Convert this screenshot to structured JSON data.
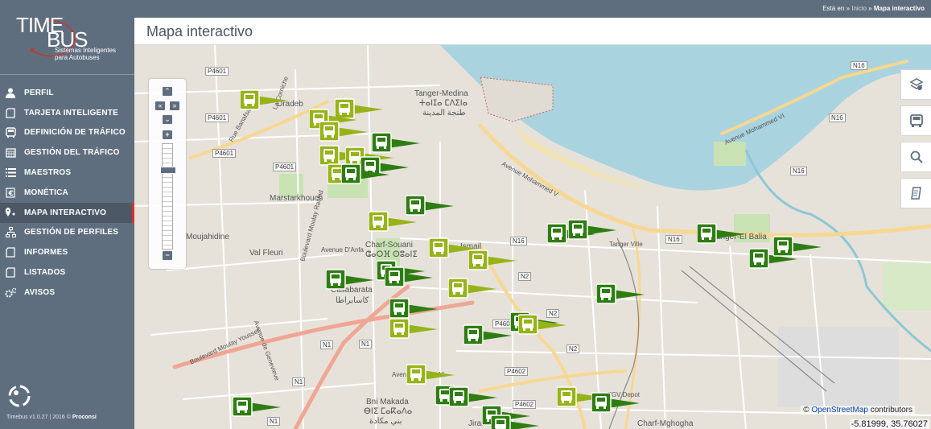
{
  "brand": {
    "name_line1": "TIME",
    "name_line2": "BUS",
    "tagline": "Sistemas Inteligentes para Autobuses",
    "version": "Timebus v1.0.27 | 2016 ©",
    "company": "Proconsi"
  },
  "breadcrumb": {
    "prefix": "Está en »",
    "home": "Inicio",
    "sep": "»",
    "current": "Mapa interactivo"
  },
  "page_title": "Mapa interactivo",
  "menu": [
    {
      "label": "PERFIL",
      "icon": "user-icon"
    },
    {
      "label": "TARJETA INTELIGENTE",
      "icon": "card-icon"
    },
    {
      "label": "DEFINICIÓN DE TRÁFICO",
      "icon": "bus-icon"
    },
    {
      "label": "GESTIÓN DEL TRÁFICO",
      "icon": "calendar-icon"
    },
    {
      "label": "MAESTROS",
      "icon": "list-icon"
    },
    {
      "label": "MONÉTICA",
      "icon": "money-icon"
    },
    {
      "label": "MAPA INTERACTIVO",
      "icon": "map-pin-icon",
      "active": true
    },
    {
      "label": "GESTIÓN DE PERFILES",
      "icon": "sitemap-icon"
    },
    {
      "label": "INFORMES",
      "icon": "report-icon"
    },
    {
      "label": "LISTADOS",
      "icon": "listing-icon"
    },
    {
      "label": "AVISOS",
      "icon": "gears-icon"
    }
  ],
  "map_tools": [
    "layers-map-icon",
    "bus-icon",
    "search-icon",
    "document-icon"
  ],
  "map_labels": {
    "places": [
      "Tanger-Medina",
      "ⵜⴰⵏⵊⴰ ⵎⴷⵉⵏⴰ",
      "طنجة المدينة",
      "Dradeb",
      "Marstarkhouch",
      "Moujahidine",
      "Val Fleuri",
      "Charf-Souani",
      "ⵛⴰⵔⴼ ⵙⵓⴰⵏⵉ",
      "Casabarata",
      "كاسابراطا",
      "Tanger-El Balia",
      "Tanger Ville",
      "Bni Makada",
      "ⴱⵏⵉ ⵎⴰⴽⴰⴷⴰ",
      "بني مكادة",
      "Charf-Mghogha",
      "Ismail",
      "Jirari",
      "TGV Depot"
    ],
    "roads": [
      "P4601",
      "P4601",
      "P4601",
      "P4601",
      "N16",
      "N16",
      "N16",
      "N16",
      "N16",
      "N2",
      "N2",
      "N2",
      "N1",
      "N1",
      "N1",
      "N1",
      "P4602",
      "P4602",
      "P4602"
    ],
    "streets": [
      "Avenue Mohammed VI",
      "Avenue Mohammed V",
      "Boulevard Moulay Rachid",
      "Avenue Moulay Ali",
      "Boulevard Moulay Youssef",
      "Avenue de Genevieve",
      "Avenue D'Anfa",
      "La Corniche",
      "Rue Banafsa"
    ]
  },
  "markers": [
    {
      "color": "#97b31a"
    },
    {
      "color": "#97b31a"
    },
    {
      "color": "#97b31a"
    },
    {
      "color": "#97b31a"
    },
    {
      "color": "#97b31a"
    },
    {
      "color": "#97b31a"
    },
    {
      "color": "#97b31a"
    },
    {
      "color": "#2f7d12"
    },
    {
      "color": "#2f7d12"
    },
    {
      "color": "#2f7d12"
    },
    {
      "color": "#97b31a"
    },
    {
      "color": "#97b31a"
    },
    {
      "color": "#97b31a"
    },
    {
      "color": "#2f7d12"
    },
    {
      "color": "#2f7d12"
    },
    {
      "color": "#2f7d12"
    },
    {
      "color": "#97b31a"
    },
    {
      "color": "#2f7d12"
    },
    {
      "color": "#97b31a"
    },
    {
      "color": "#2f7d12"
    },
    {
      "color": "#2f7d12"
    },
    {
      "color": "#97b31a"
    },
    {
      "color": "#2f7d12"
    },
    {
      "color": "#2f7d12"
    },
    {
      "color": "#2f7d12"
    },
    {
      "color": "#2f7d12"
    },
    {
      "color": "#2f7d12"
    },
    {
      "color": "#2f7d12"
    },
    {
      "color": "#2f7d12"
    },
    {
      "color": "#97b31a"
    },
    {
      "color": "#2f7d12"
    },
    {
      "color": "#2f7d12"
    },
    {
      "color": "#97b31a"
    },
    {
      "color": "#2f7d12"
    },
    {
      "color": "#2f7d12"
    },
    {
      "color": "#2f7d12"
    },
    {
      "color": "#2f7d12"
    }
  ],
  "attribution": {
    "symbol": "©",
    "link": "OpenStreetMap",
    "suffix": "contributors"
  },
  "coords": "-5.81999, 35.76027",
  "colors": {
    "sidebar": "#5f6e7f",
    "active_accent": "#e0302f",
    "sea": "#a9d3df",
    "bus_light": "#97b31a",
    "bus_dark": "#2f7d12"
  }
}
